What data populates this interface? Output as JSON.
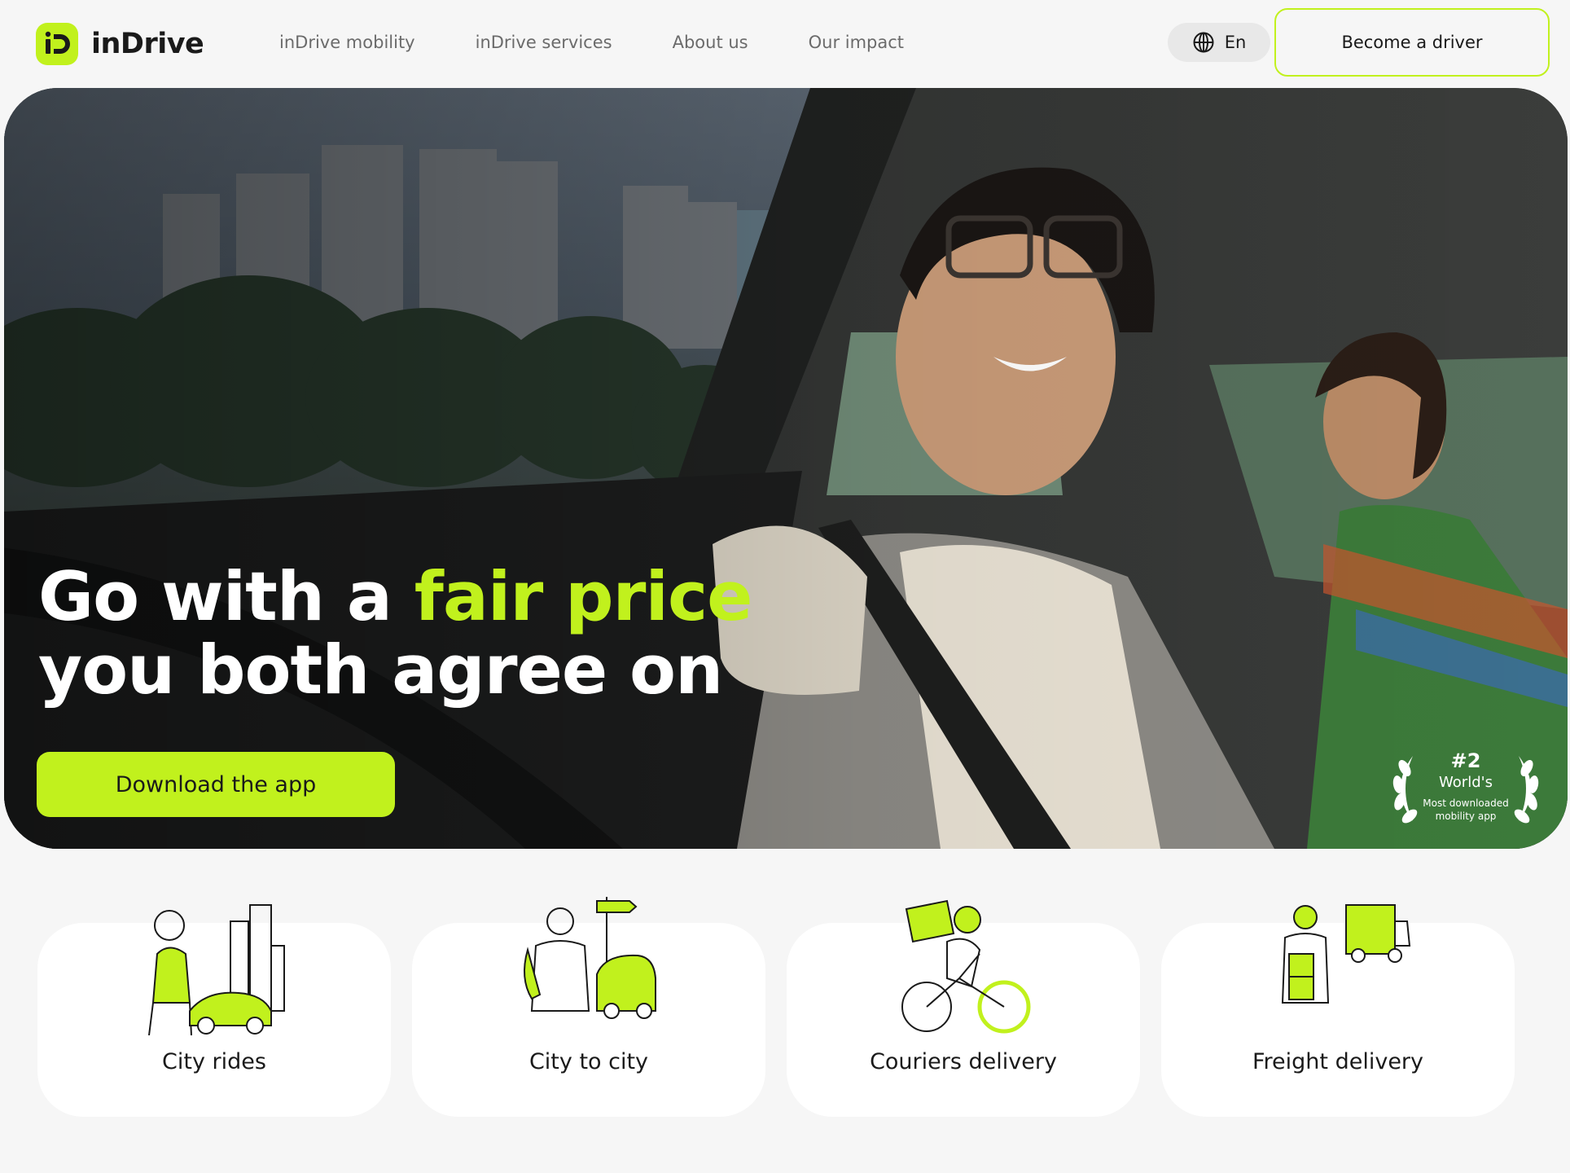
{
  "brand": {
    "name": "inDrive",
    "accent": "#c1f11d"
  },
  "nav": {
    "items": [
      "inDrive mobility",
      "inDrive services",
      "About us",
      "Our impact"
    ]
  },
  "language": {
    "label": "En",
    "icon": "globe-icon"
  },
  "become_driver": "Become a driver",
  "hero": {
    "headline_part1": "Go with a ",
    "headline_accent": "fair price",
    "headline_part2": " you both agree on",
    "cta": "Download the app",
    "award": {
      "rank": "#2",
      "title": "World's",
      "subtitle": "Most downloaded mobility app"
    }
  },
  "services": [
    {
      "label": "City rides",
      "icon": "city-rides-illustration"
    },
    {
      "label": "City to city",
      "icon": "city-to-city-illustration"
    },
    {
      "label": "Couriers delivery",
      "icon": "courier-bike-illustration"
    },
    {
      "label": "Freight delivery",
      "icon": "freight-truck-illustration"
    }
  ]
}
